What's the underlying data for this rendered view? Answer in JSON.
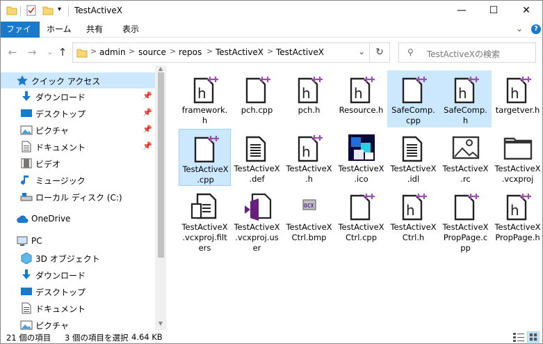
{
  "window": {
    "title": "TestActiveX"
  },
  "titlebar": {
    "minimize": "—",
    "maximize": "☐",
    "close": "✕"
  },
  "ribbon": {
    "tabs": [
      {
        "label": "ファイル"
      },
      {
        "label": "ホーム"
      },
      {
        "label": "共有"
      },
      {
        "label": "表示"
      }
    ],
    "expand": "⌄",
    "help": "?"
  },
  "nav": {
    "back": "←",
    "forward": "→",
    "recent": "⌄",
    "up": "↑",
    "breadcrumb": [
      "admin",
      "source",
      "repos",
      "TestActiveX",
      "TestActiveX"
    ],
    "sep": ">",
    "dropdown": "⌄",
    "refresh": "↻",
    "search_placeholder": "TestActiveXの検索",
    "search_glyph": "⚲"
  },
  "sidebar": {
    "items": [
      {
        "label": "クイック アクセス",
        "icon": "star-icon",
        "pinned": false
      },
      {
        "label": "ダウンロード",
        "icon": "download-icon",
        "pinned": true
      },
      {
        "label": "デスクトップ",
        "icon": "desktop-icon",
        "pinned": true
      },
      {
        "label": "ピクチャ",
        "icon": "pictures-icon",
        "pinned": true
      },
      {
        "label": "ドキュメント",
        "icon": "documents-icon",
        "pinned": true
      },
      {
        "label": "ビデオ",
        "icon": "video-icon",
        "pinned": false
      },
      {
        "label": "ミュージック",
        "icon": "music-icon",
        "pinned": false
      },
      {
        "label": "ローカル ディスク (C:)",
        "icon": "drive-icon",
        "pinned": false
      },
      {
        "label": "OneDrive",
        "icon": "cloud-icon",
        "pinned": false
      },
      {
        "label": "PC",
        "icon": "pc-icon",
        "pinned": false
      },
      {
        "label": "3D オブジェクト",
        "icon": "3d-objects-icon",
        "pinned": false
      },
      {
        "label": "ダウンロード",
        "icon": "download-icon",
        "pinned": false
      },
      {
        "label": "デスクトップ",
        "icon": "desktop-icon",
        "pinned": false
      },
      {
        "label": "ドキュメント",
        "icon": "documents-icon",
        "pinned": false
      },
      {
        "label": "ピクチャ",
        "icon": "pictures-icon",
        "pinned": false
      }
    ],
    "pin_glyph": "📌"
  },
  "files": [
    {
      "name": "framework.h",
      "type": "h"
    },
    {
      "name": "pch.cpp",
      "type": "cpp"
    },
    {
      "name": "pch.h",
      "type": "h"
    },
    {
      "name": "Resource.h",
      "type": "h"
    },
    {
      "name": "SafeComp.cpp",
      "type": "cpp"
    },
    {
      "name": "SafeComp.h",
      "type": "h"
    },
    {
      "name": "targetver.h",
      "type": "h"
    },
    {
      "name": "TestActiveX.cpp",
      "type": "cpp"
    },
    {
      "name": "TestActiveX.def",
      "type": "text"
    },
    {
      "name": "TestActiveX.h",
      "type": "h"
    },
    {
      "name": "TestActiveX.ico",
      "type": "ico"
    },
    {
      "name": "TestActiveX.idl",
      "type": "text"
    },
    {
      "name": "TestActiveX.rc",
      "type": "image"
    },
    {
      "name": "TestActiveX.vcxproj",
      "type": "folder"
    },
    {
      "name": "TestActiveX.vcxproj.filters",
      "type": "filters"
    },
    {
      "name": "TestActiveX.vcxproj.user",
      "type": "vs"
    },
    {
      "name": "TestActiveXCtrl.bmp",
      "type": "ocx"
    },
    {
      "name": "TestActiveXCtrl.cpp",
      "type": "cpp"
    },
    {
      "name": "TestActiveXCtrl.h",
      "type": "h"
    },
    {
      "name": "TestActiveXPropPage.cpp",
      "type": "cpp"
    },
    {
      "name": "TestActiveXPropPage.h",
      "type": "h"
    }
  ],
  "file_labels": [
    [
      "framework.",
      "h"
    ],
    [
      "pch.cpp"
    ],
    [
      "pch.h"
    ],
    [
      "Resource.h"
    ],
    [
      "SafeComp.",
      "cpp"
    ],
    [
      "SafeComp.",
      "h"
    ],
    [
      "targetver.h"
    ],
    [
      "TestActiveX",
      ".cpp"
    ],
    [
      "TestActiveX",
      ".def"
    ],
    [
      "TestActiveX",
      ".h"
    ],
    [
      "TestActiveX",
      ".ico"
    ],
    [
      "TestActiveX",
      ".idl"
    ],
    [
      "TestActiveX",
      ".rc"
    ],
    [
      "TestActiveX",
      ".vcxproj"
    ],
    [
      "TestActiveX",
      ".vcxproj.filt",
      "ers"
    ],
    [
      "TestActiveX",
      ".vcxproj.us",
      "er"
    ],
    [
      "TestActiveX",
      "Ctrl.bmp"
    ],
    [
      "TestActiveX",
      "Ctrl.cpp"
    ],
    [
      "TestActiveX",
      "Ctrl.h"
    ],
    [
      "TestActiveX",
      "PropPage.c",
      "pp"
    ],
    [
      "TestActiveX",
      "PropPage.h"
    ]
  ],
  "selected": [
    "SafeComp.cpp",
    "SafeComp.h",
    "TestActiveX.cpp"
  ],
  "status": {
    "count": "21 個の項目",
    "selection": "3 個の項目を選択",
    "size": "4.64 KB"
  },
  "colors": {
    "accent": "#1979ca",
    "selection": "#cce8ff",
    "plus": "#9a4eae",
    "folder": "#f8d775"
  }
}
